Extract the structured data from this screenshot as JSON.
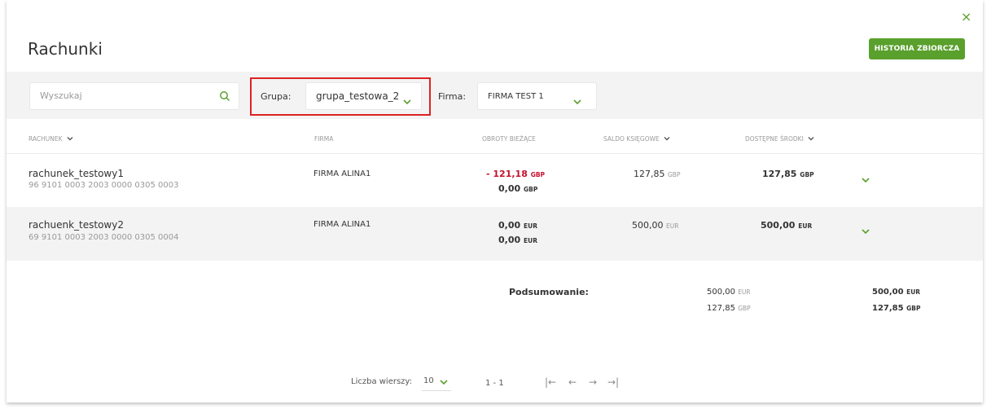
{
  "header": {
    "title": "Rachunki",
    "history_button": "HISTORIA ZBIORCZA",
    "close_icon": "×"
  },
  "filters": {
    "search_placeholder": "Wyszukaj",
    "group_label": "Grupa:",
    "group_value": "grupa_testowa_2",
    "firm_label": "Firma:",
    "firm_value": "FIRMA TEST 1"
  },
  "table": {
    "columns": [
      "RACHUNEK",
      "FIRMA",
      "OBROTY BIEŻĄCE",
      "SALDO KSIĘGOWE",
      "DOSTĘPNE ŚRODKI"
    ],
    "rows": [
      {
        "name": "rachunek_testowy1",
        "number": "96 9101 0003 2003 0000 0305 0003",
        "firm": "FIRMA ALINA1",
        "turnover1": "- 121,18",
        "turnover1_cur": "GBP",
        "turnover2": "0,00",
        "turnover2_cur": "GBP",
        "balance": "127,85",
        "balance_cur": "GBP",
        "available": "127,85",
        "available_cur": "GBP"
      },
      {
        "name": "rachuenk_testowy2",
        "number": "69 9101 0003 2003 0000 0305 0004",
        "firm": "FIRMA ALINA1",
        "turnover1": "0,00",
        "turnover1_cur": "EUR",
        "turnover2": "0,00",
        "turnover2_cur": "EUR",
        "balance": "500,00",
        "balance_cur": "EUR",
        "available": "500,00",
        "available_cur": "EUR"
      }
    ]
  },
  "summary": {
    "label": "Podsumowanie:",
    "balance": [
      {
        "value": "500,00",
        "cur": "EUR"
      },
      {
        "value": "127,85",
        "cur": "GBP"
      }
    ],
    "available": [
      {
        "value": "500,00",
        "cur": "EUR"
      },
      {
        "value": "127,85",
        "cur": "GBP"
      }
    ]
  },
  "pagination": {
    "rows_label": "Liczba wierszy:",
    "rows_value": "10",
    "range": "1 - 1"
  },
  "colors": {
    "accent": "#5aa02c",
    "negative": "#c4122f",
    "highlight": "#dd2222"
  }
}
